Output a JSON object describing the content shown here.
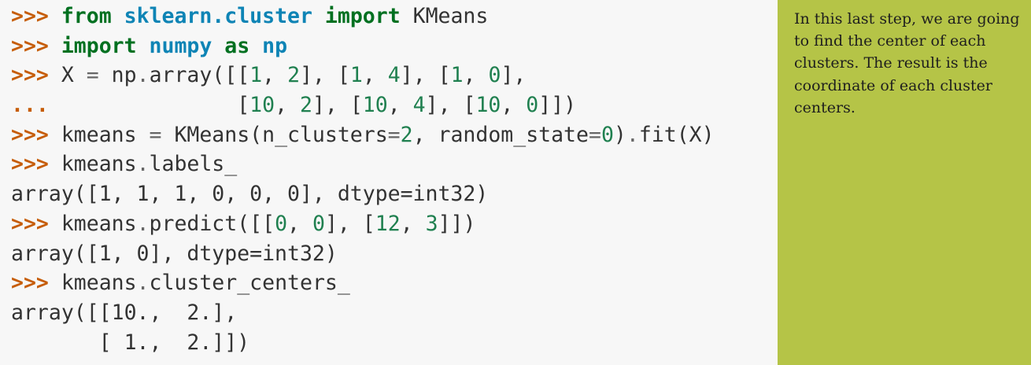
{
  "colors": {
    "code_background": "#f7f7f7",
    "note_background": "#b5c447",
    "prompt": "#c65d09",
    "keyword": "#007020",
    "module_name": "#0e84b5",
    "number": "#208050",
    "text": "#333333"
  },
  "code_lines": [
    [
      {
        "c": "p",
        "t": ">>> "
      },
      {
        "c": "kw",
        "t": "from"
      },
      {
        "c": "",
        "t": " "
      },
      {
        "c": "nn",
        "t": "sklearn.cluster"
      },
      {
        "c": "",
        "t": " "
      },
      {
        "c": "kw",
        "t": "import"
      },
      {
        "c": "",
        "t": " KMeans"
      }
    ],
    [
      {
        "c": "p",
        "t": ">>> "
      },
      {
        "c": "kw",
        "t": "import"
      },
      {
        "c": "",
        "t": " "
      },
      {
        "c": "nn",
        "t": "numpy"
      },
      {
        "c": "",
        "t": " "
      },
      {
        "c": "kw",
        "t": "as"
      },
      {
        "c": "",
        "t": " "
      },
      {
        "c": "nn",
        "t": "np"
      }
    ],
    [
      {
        "c": "p",
        "t": ">>> "
      },
      {
        "c": "",
        "t": "X "
      },
      {
        "c": "o",
        "t": "="
      },
      {
        "c": "",
        "t": " np"
      },
      {
        "c": "o",
        "t": "."
      },
      {
        "c": "",
        "t": "array([["
      },
      {
        "c": "n",
        "t": "1"
      },
      {
        "c": "",
        "t": ", "
      },
      {
        "c": "n",
        "t": "2"
      },
      {
        "c": "",
        "t": "], ["
      },
      {
        "c": "n",
        "t": "1"
      },
      {
        "c": "",
        "t": ", "
      },
      {
        "c": "n",
        "t": "4"
      },
      {
        "c": "",
        "t": "], ["
      },
      {
        "c": "n",
        "t": "1"
      },
      {
        "c": "",
        "t": ", "
      },
      {
        "c": "n",
        "t": "0"
      },
      {
        "c": "",
        "t": "],"
      }
    ],
    [
      {
        "c": "p",
        "t": "... "
      },
      {
        "c": "",
        "t": "              ["
      },
      {
        "c": "n",
        "t": "10"
      },
      {
        "c": "",
        "t": ", "
      },
      {
        "c": "n",
        "t": "2"
      },
      {
        "c": "",
        "t": "], ["
      },
      {
        "c": "n",
        "t": "10"
      },
      {
        "c": "",
        "t": ", "
      },
      {
        "c": "n",
        "t": "4"
      },
      {
        "c": "",
        "t": "], ["
      },
      {
        "c": "n",
        "t": "10"
      },
      {
        "c": "",
        "t": ", "
      },
      {
        "c": "n",
        "t": "0"
      },
      {
        "c": "",
        "t": "]])"
      }
    ],
    [
      {
        "c": "p",
        "t": ">>> "
      },
      {
        "c": "",
        "t": "kmeans "
      },
      {
        "c": "o",
        "t": "="
      },
      {
        "c": "",
        "t": " KMeans(n_clusters"
      },
      {
        "c": "o",
        "t": "="
      },
      {
        "c": "n",
        "t": "2"
      },
      {
        "c": "",
        "t": ", random_state"
      },
      {
        "c": "o",
        "t": "="
      },
      {
        "c": "n",
        "t": "0"
      },
      {
        "c": "",
        "t": ")"
      },
      {
        "c": "o",
        "t": "."
      },
      {
        "c": "",
        "t": "fit(X)"
      }
    ],
    [
      {
        "c": "p",
        "t": ">>> "
      },
      {
        "c": "",
        "t": "kmeans"
      },
      {
        "c": "o",
        "t": "."
      },
      {
        "c": "",
        "t": "labels_"
      }
    ],
    [
      {
        "c": "",
        "t": "array([1, 1, 1, 0, 0, 0], dtype=int32)"
      }
    ],
    [
      {
        "c": "p",
        "t": ">>> "
      },
      {
        "c": "",
        "t": "kmeans"
      },
      {
        "c": "o",
        "t": "."
      },
      {
        "c": "",
        "t": "predict([["
      },
      {
        "c": "n",
        "t": "0"
      },
      {
        "c": "",
        "t": ", "
      },
      {
        "c": "n",
        "t": "0"
      },
      {
        "c": "",
        "t": "], ["
      },
      {
        "c": "n",
        "t": "12"
      },
      {
        "c": "",
        "t": ", "
      },
      {
        "c": "n",
        "t": "3"
      },
      {
        "c": "",
        "t": "]])"
      }
    ],
    [
      {
        "c": "",
        "t": "array([1, 0], dtype=int32)"
      }
    ],
    [
      {
        "c": "p",
        "t": ">>> "
      },
      {
        "c": "",
        "t": "kmeans"
      },
      {
        "c": "o",
        "t": "."
      },
      {
        "c": "",
        "t": "cluster_centers_"
      }
    ],
    [
      {
        "c": "",
        "t": "array([[10.,  2.],"
      }
    ],
    [
      {
        "c": "",
        "t": "       [ 1.,  2.]])"
      }
    ]
  ],
  "note": {
    "text": "In this last step, we are going to find the center of each clusters. The result is the coordinate of each cluster centers."
  }
}
